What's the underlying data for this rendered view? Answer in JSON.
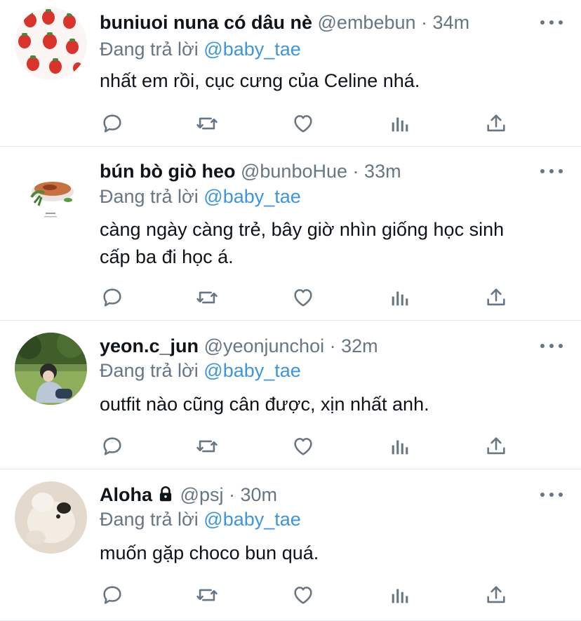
{
  "tweets": [
    {
      "name": "buniuoi nuna có dâu nè",
      "handle": "@embebun",
      "sep": "·",
      "time": "34m",
      "reply_prefix": "Đang trả lời",
      "reply_to": "@baby_tae",
      "text": "nhất em rồi, cục cưng của Celine nhá.",
      "avatar": "strawberry-pattern-avatar"
    },
    {
      "name": "bún bò giò heo",
      "handle": "@bunboHue",
      "sep": "·",
      "time": "33m",
      "reply_prefix": "Đang trả lời",
      "reply_to": "@baby_tae",
      "text": "càng ngày càng trẻ, bây giờ nhìn giống học sinh cấp ba đi học á.",
      "avatar": "noodle-bowl-avatar"
    },
    {
      "name": "yeon.c_jun",
      "handle": "@yeonjunchoi",
      "sep": "·",
      "time": "32m",
      "reply_prefix": "Đang trả lời",
      "reply_to": "@baby_tae",
      "text": "outfit nào cũng cân được, xịn nhất anh.",
      "avatar": "park-photo-avatar"
    },
    {
      "name": "Aloha",
      "handle": "@psj",
      "sep": "·",
      "time": "30m",
      "reply_prefix": "Đang trả lời",
      "reply_to": "@baby_tae",
      "text": "muốn gặp choco bun quá.",
      "avatar": "puppy-avatar",
      "locked": true
    }
  ],
  "colors": {
    "text": "#0f1419",
    "secondary": "#687684",
    "link": "#3b95e0",
    "divider": "#e6e9eb"
  },
  "icons": [
    "reply-icon",
    "retweet-icon",
    "like-icon",
    "analytics-icon",
    "share-icon",
    "more-icon",
    "lock-icon"
  ]
}
